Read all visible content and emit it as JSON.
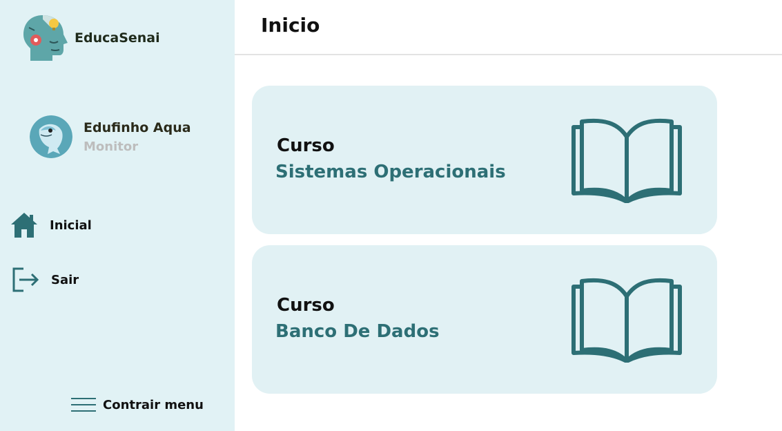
{
  "brand": {
    "name": "EducaSenai"
  },
  "user": {
    "name": "Edufinho Aqua",
    "role": "Monitor"
  },
  "nav": [
    {
      "label": "Inicial",
      "icon": "home-icon"
    },
    {
      "label": "Sair",
      "icon": "logout-icon"
    }
  ],
  "collapse": {
    "label": "Contrair menu",
    "icon": "menu-icon"
  },
  "header": {
    "title": "Inicio"
  },
  "courses": [
    {
      "kicker": "Curso",
      "name": "Sistemas Operacionais",
      "icon": "book-icon"
    },
    {
      "kicker": "Curso",
      "name": "Banco De Dados",
      "icon": "book-icon"
    }
  ],
  "colors": {
    "accent": "#2d6f75",
    "sidebar_bg": "#e1f2f5",
    "card_bg": "#e1f1f4"
  }
}
